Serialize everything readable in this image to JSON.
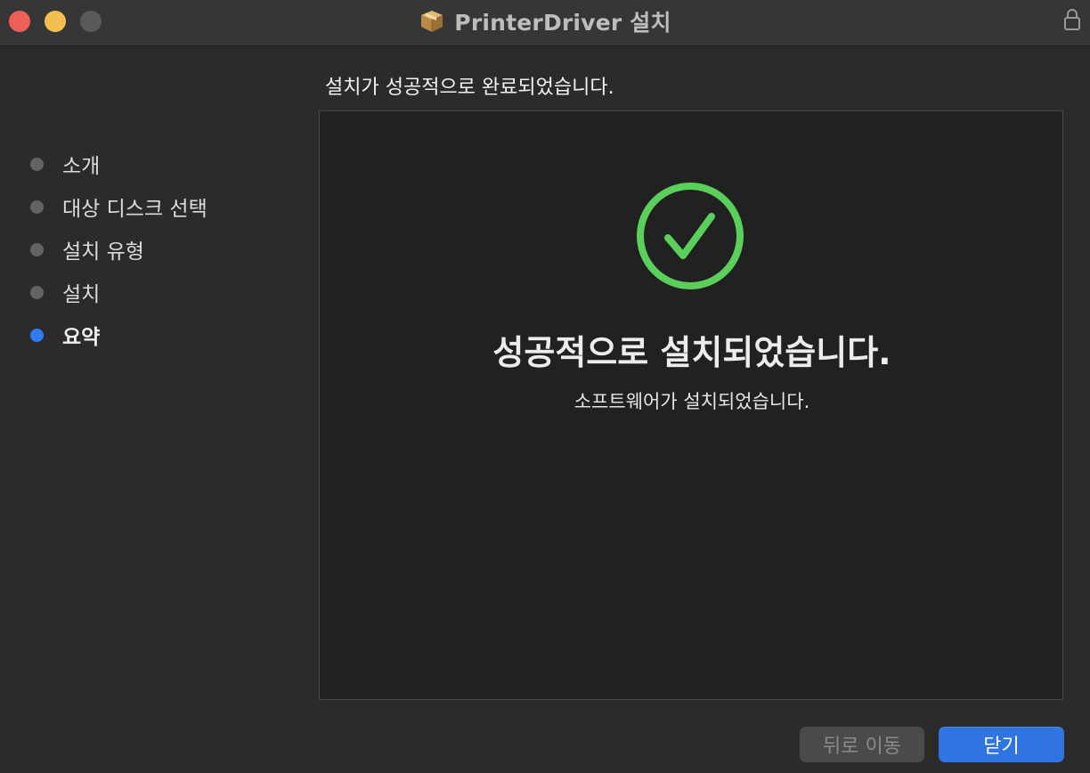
{
  "window": {
    "title": "PrinterDriver 설치"
  },
  "sidebar": {
    "steps": [
      {
        "label": "소개",
        "active": false
      },
      {
        "label": "대상 디스크 선택",
        "active": false
      },
      {
        "label": "설치 유형",
        "active": false
      },
      {
        "label": "설치",
        "active": false
      },
      {
        "label": "요약",
        "active": true
      }
    ]
  },
  "main": {
    "status_heading": "설치가 성공적으로 완료되었습니다.",
    "success_title": "성공적으로 설치되었습니다.",
    "success_message": "소프트웨어가 설치되었습니다."
  },
  "buttons": {
    "back_label": "뒤로 이동",
    "close_label": "닫기"
  },
  "icons": {
    "title_icon": "package-icon",
    "lock": "lock-icon",
    "success": "checkmark-circle-icon"
  },
  "colors": {
    "accent": "#2f74e0",
    "success": "#5ad05a",
    "active_step": "#2f7bf5"
  }
}
